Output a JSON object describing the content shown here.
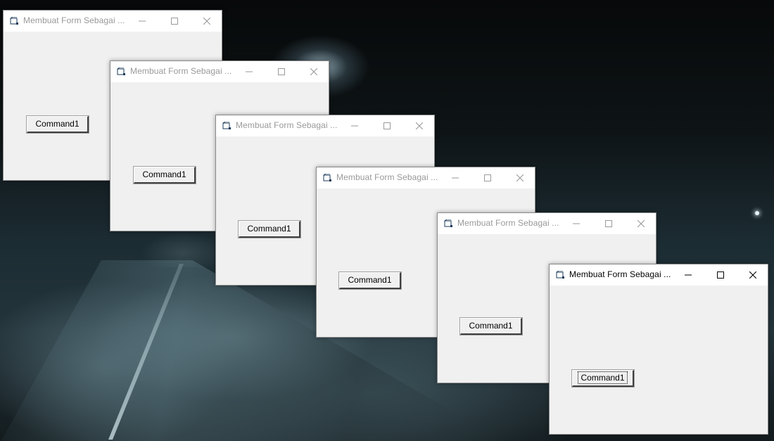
{
  "desktop": {
    "wallpaper": "night-rainy-road"
  },
  "windows": [
    {
      "title": "Membuat Form Sebagai ...",
      "button_label": "Command1",
      "active": false
    },
    {
      "title": "Membuat Form Sebagai ...",
      "button_label": "Command1",
      "active": false
    },
    {
      "title": "Membuat Form Sebagai ...",
      "button_label": "Command1",
      "active": false
    },
    {
      "title": "Membuat Form Sebagai ...",
      "button_label": "Command1",
      "active": false
    },
    {
      "title": "Membuat Form Sebagai ...",
      "button_label": "Command1",
      "active": false
    },
    {
      "title": "Membuat Form Sebagai ...",
      "button_label": "Command1",
      "active": true
    }
  ],
  "icons": {
    "app": "vb-form-icon",
    "minimize": "minimize-icon",
    "maximize": "maximize-icon",
    "close": "close-icon"
  },
  "colors": {
    "inactive_title": "#999999",
    "active_title": "#000000",
    "form_background": "#f0f0f0"
  }
}
